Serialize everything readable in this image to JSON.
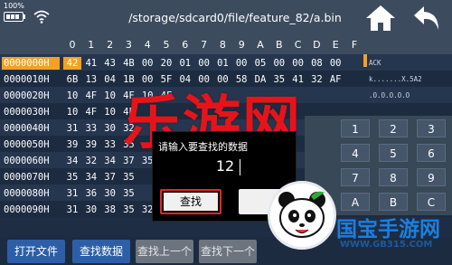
{
  "status": {
    "battery": "100%"
  },
  "path": "/storage/sdcard0/file/feature_82/a.bin",
  "header": [
    "0",
    "1",
    "2",
    "3",
    "4",
    "5",
    "6",
    "7",
    "8",
    "9",
    "A",
    "B",
    "C",
    "D",
    "E",
    "F"
  ],
  "rows": [
    {
      "addr": "0000000H",
      "cells": [
        "42",
        "41",
        "43",
        "4B",
        "00",
        "20",
        "01",
        "00",
        "01",
        "00",
        "05",
        "00",
        "00",
        "08",
        "00"
      ],
      "ascii": "ACK"
    },
    {
      "addr": "0000010H",
      "cells": [
        "6B",
        "13",
        "04",
        "1B",
        "00",
        "5F",
        "04",
        "00",
        "00",
        "58",
        "DA",
        "35",
        "41",
        "32",
        "AF"
      ],
      "ascii": "k.......X.5A2"
    },
    {
      "addr": "0000020H",
      "cells": [
        "10",
        "4F",
        "10",
        "4F",
        "10",
        "4F",
        "",
        "",
        "",
        "",
        "",
        "",
        "",
        "",
        ""
      ],
      "ascii": ".O.O.O.O.O"
    },
    {
      "addr": "0000030H",
      "cells": [
        "10",
        "4F",
        "10",
        "4F",
        "",
        "",
        "",
        "",
        "",
        "",
        "",
        "",
        "",
        "",
        ""
      ],
      "ascii": ""
    },
    {
      "addr": "0000040H",
      "cells": [
        "31",
        "33",
        "30",
        "32",
        "",
        "",
        "",
        "",
        "",
        "",
        "",
        "",
        "",
        "",
        ""
      ],
      "ascii": ""
    },
    {
      "addr": "0000050H",
      "cells": [
        "39",
        "39",
        "33",
        "35",
        "",
        "",
        "",
        "",
        "",
        "",
        "",
        "",
        "",
        "",
        ""
      ],
      "ascii": ""
    },
    {
      "addr": "0000060H",
      "cells": [
        "34",
        "32",
        "34",
        "37",
        "35",
        "",
        "",
        "",
        "",
        "",
        "",
        "",
        "",
        "",
        ""
      ],
      "ascii": ""
    },
    {
      "addr": "0000070H",
      "cells": [
        "35",
        "34",
        "37",
        "35",
        "",
        "",
        "",
        "",
        "",
        "",
        "",
        "",
        "",
        "",
        ""
      ],
      "ascii": ""
    },
    {
      "addr": "0000080H",
      "cells": [
        "31",
        "36",
        "30",
        "35",
        "",
        "",
        "",
        "",
        "",
        "",
        "",
        "",
        "",
        "",
        ""
      ],
      "ascii": ""
    },
    {
      "addr": "0000090H",
      "cells": [
        "31",
        "30",
        "38",
        "35",
        "32",
        "",
        "",
        "",
        "",
        "",
        "",
        "",
        "",
        "",
        ""
      ],
      "ascii": ""
    }
  ],
  "watermark": "乐游网",
  "dialog": {
    "title": "请输入要查找的数据",
    "input_value": "12",
    "find_label": "查找"
  },
  "keypad": [
    "1",
    "2",
    "3",
    "4",
    "5",
    "6",
    "7",
    "8",
    "9",
    "A",
    "B",
    "C"
  ],
  "bottom": {
    "open_file": "打开文件",
    "find_data": "查找数据",
    "find_prev": "查找上一个",
    "find_next": "查找下一个"
  },
  "logo": {
    "name": "国宝手游网",
    "url": "WWW.GB315.COM"
  },
  "colors": {
    "selection": "#f1a223",
    "accent_blue": "#2c5fa7",
    "watermark_red": "#e6141a"
  }
}
